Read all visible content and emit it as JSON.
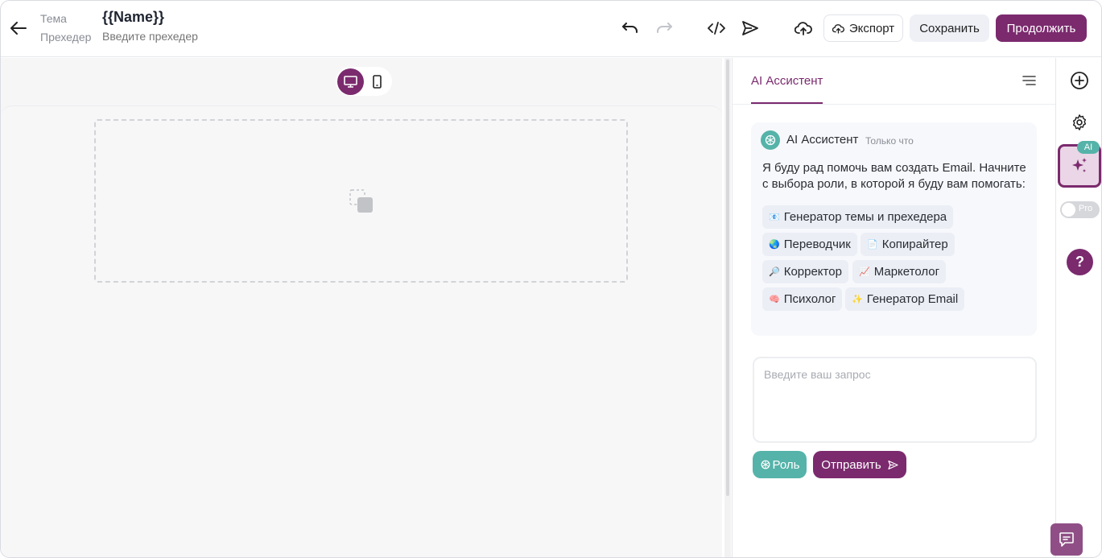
{
  "header": {
    "subject_label": "Тема",
    "subject_value": "{{Name}}",
    "preheader_label": "Прехедер",
    "preheader_placeholder": "Введите прехедер",
    "export_label": "Экспорт",
    "save_label": "Сохранить",
    "continue_label": "Продолжить"
  },
  "panel": {
    "tab_label": "AI Ассистент",
    "message": {
      "author": "AI Ассистент",
      "time": "Только что",
      "text": "Я буду рад помочь вам создать Email. Начните с выбора роли, в которой я буду вам помогать:"
    },
    "roles": [
      {
        "emoji": "📧",
        "label": "Генератор темы и прехедера"
      },
      {
        "emoji": "🌏",
        "label": "Переводчик"
      },
      {
        "emoji": "📄",
        "label": "Копирайтер"
      },
      {
        "emoji": "🔎",
        "label": "Корректор"
      },
      {
        "emoji": "📈",
        "label": "Маркетолог"
      },
      {
        "emoji": "🧠",
        "label": "Психолог"
      },
      {
        "emoji": "✨",
        "label": "Генератор Email"
      }
    ],
    "prompt_placeholder": "Введите ваш запрос",
    "role_button": "Роль",
    "send_button": "Отправить"
  },
  "rail": {
    "ai_badge": "AI",
    "pro_label": "Pro",
    "help_label": "?"
  },
  "colors": {
    "brand": "#7b2a6e",
    "teal": "#55b3a9"
  }
}
